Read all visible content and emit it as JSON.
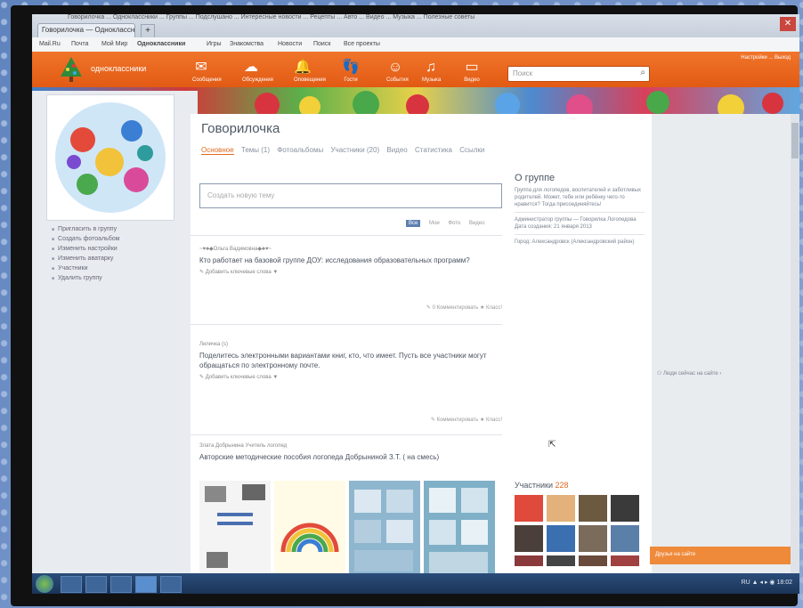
{
  "browser": {
    "tab_title": "Говорилочка — Одноклассники",
    "new_tab": "+",
    "url_bar_text": "Говорилочка ... Одноклассники ... Группы ... Подслушано ... Интересные новости ... Рецепты ... Авто ... Видео ... Музыка ... Полезные советы",
    "bookmarks": [
      "Mail.Ru",
      "Почта",
      "Мой Мир",
      "Одноклассники",
      "Игры",
      "Знакомства",
      "Новости",
      "Поиск",
      "Все проекты"
    ],
    "close": "✕"
  },
  "navbar": {
    "logo_text": "одноклассники",
    "icons": [
      {
        "name": "messages-icon",
        "glyph": "✉",
        "label": "Сообщения"
      },
      {
        "name": "discussions-icon",
        "glyph": "☁",
        "label": "Обсуждения"
      },
      {
        "name": "notifications-icon",
        "glyph": "🔔",
        "label": "Оповещения"
      },
      {
        "name": "guests-icon",
        "glyph": "👣",
        "label": "Гости"
      },
      {
        "name": "events-icon",
        "glyph": "☺",
        "label": "События"
      },
      {
        "name": "music-icon",
        "glyph": "♫",
        "label": "Музыка"
      },
      {
        "name": "video-icon",
        "glyph": "▭",
        "label": "Видео"
      }
    ],
    "search_placeholder": "Поиск",
    "topright": "Настройки ... Выход"
  },
  "group": {
    "title": "Говорилочка",
    "tabs": [
      "Основное",
      "Темы (1)",
      "Фотоальбомы",
      "Участники (20)",
      "Видео",
      "Статистика",
      "Ссылки"
    ],
    "new_topic_placeholder": "Создать новую тему",
    "filters": [
      "Все",
      "Мои",
      "Фото",
      "Видео"
    ]
  },
  "left_menu": [
    "Пригласить в группу",
    "Создать фотоальбом",
    "Изменить настройки",
    "Изменить аватарку",
    "Участники",
    "Удалить группу"
  ],
  "posts": [
    {
      "author": "~♥♣◆Ольга Вадимовна◆♣♥~",
      "text": "Кто работает на базовой группе ДОУ: исследования образовательных программ?",
      "tags": "✎ Добавить ключевые слова ▼",
      "meta": "✎ 0 Комментировать   ★ Класс!"
    },
    {
      "author": "Лиличка (s)",
      "text": "Поделитесь электронными вариантами книг, кто, что имеет. Пусть все участники могут обращаться по электронному почте.",
      "tags": "✎ Добавить ключевые слова ▼",
      "meta": "✎ Комментировать   ★ Класс!"
    },
    {
      "author": "Злата Добрынина Учитель логопед",
      "text": "Авторские методические пособия логопеда Добрыниной З.Т. ( на смесь)",
      "tags": "",
      "meta": ""
    }
  ],
  "about": {
    "title": "О группе",
    "desc": "Группа для логопедов, воспитателей и заботливых родителей. Может, тебе или ребёнку чего-то нравится? Тогда присоединяйтесь!",
    "admin": "Администратор группы — Говорилка Логопедова",
    "created": "Дата создания: 21 января 2013",
    "city": "Город: Александровск (Александровский район)"
  },
  "members": {
    "label": "Участники",
    "count": "228"
  },
  "rightcol": {
    "online": "⚇ Люди сейчас на сайте ›",
    "chat": "Друзья на сайте"
  },
  "taskbar": {
    "tray": "RU  ▲ ◂ ▸ ◉  18:02"
  },
  "colors": {
    "ok_orange": "#e8641b",
    "link_orange": "#e06a1f",
    "taskbar": "#1b3457"
  }
}
